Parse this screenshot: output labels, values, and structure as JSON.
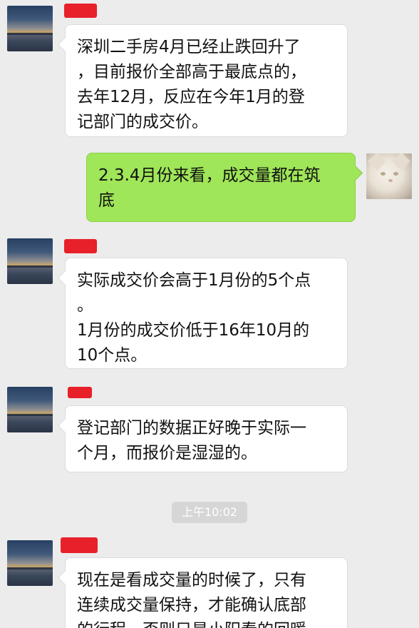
{
  "messages": [
    {
      "sender": "other",
      "text": "深圳二手房4月已经止跌回升了\n，目前报价全部高于最底点的，\n去年12月，反应在今年1月的登\n记部门的成交价。"
    },
    {
      "sender": "me",
      "text": "2.3.4月份来看，成交量都在筑\n底"
    },
    {
      "sender": "other",
      "text": "实际成交价会高于1月份的5个点\n。\n1月份的成交价低于16年10月的\n10个点。"
    },
    {
      "sender": "other",
      "text": "登记部门的数据正好晚于实际一\n个月，而报价是湿湿的。"
    },
    {
      "sender": "other",
      "text": "现在是看成交量的时候了，只有\n连续成交量保持，才能确认底部\n的行程，否则只是小阳春的回暖"
    }
  ],
  "timestamp": "上午10:02",
  "colors": {
    "background": "#ececec",
    "sent_bubble": "#9fe658",
    "received_bubble": "#ffffff",
    "redaction": "#e8202a"
  },
  "icons": {
    "sender_avatar": "sunset-lake-photo",
    "my_avatar": "white-cat-photo"
  }
}
